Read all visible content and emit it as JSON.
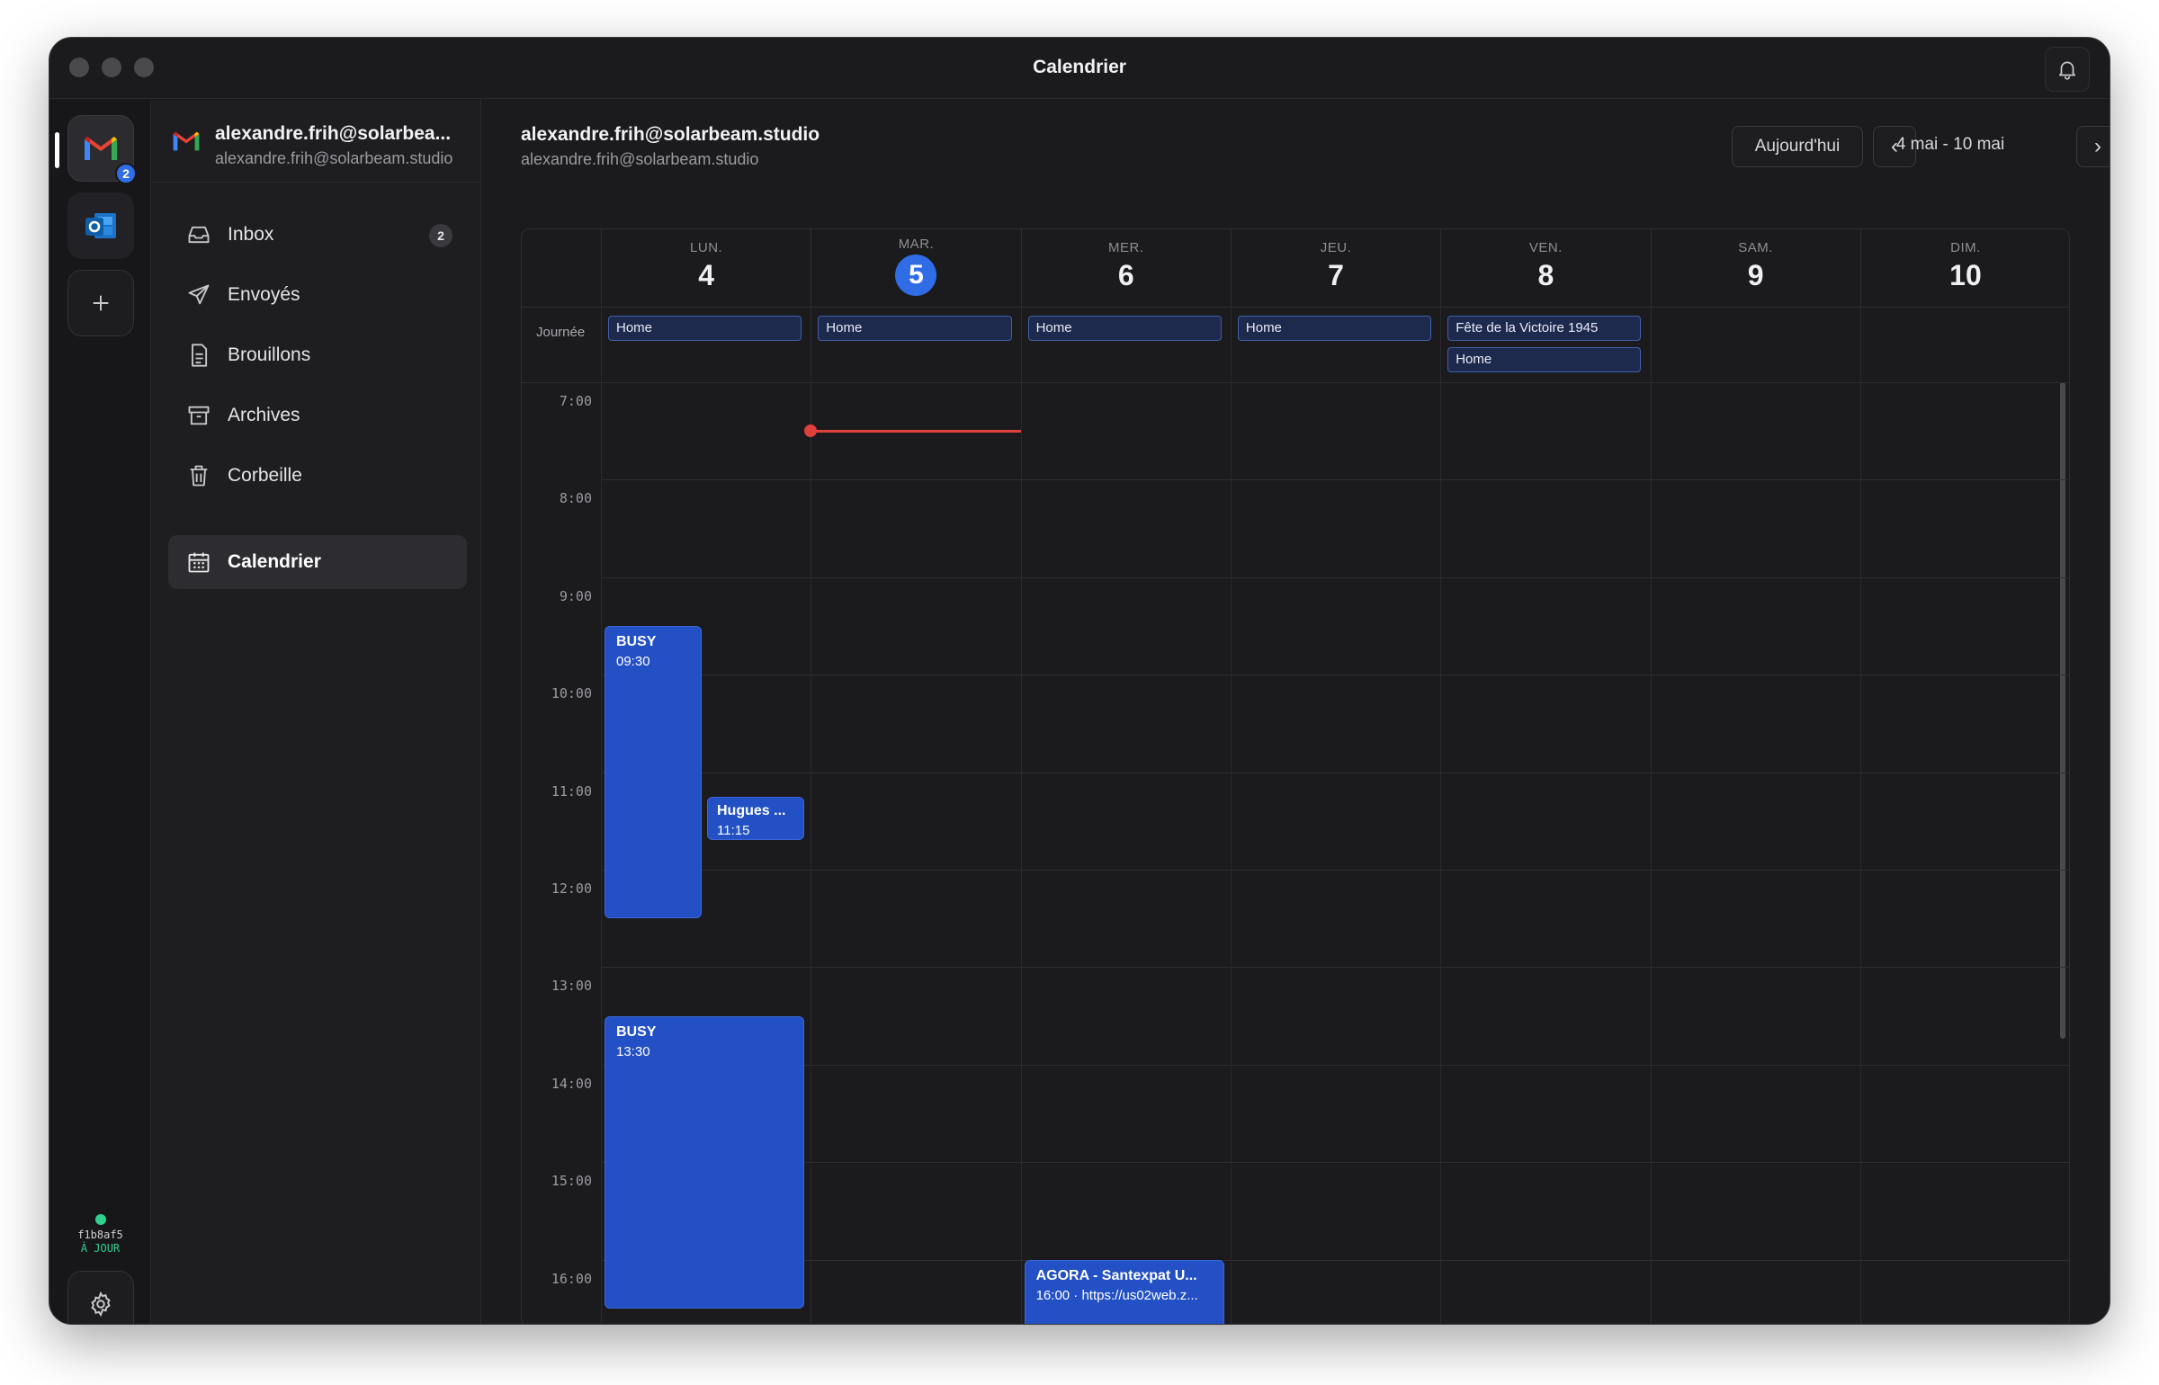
{
  "window": {
    "title": "Calendrier"
  },
  "rail": {
    "gmail_badge": "2",
    "sync_hash": "f1b8af5",
    "sync_status": "À JOUR"
  },
  "account": {
    "name": "alexandre.frih@solarbea...",
    "email": "alexandre.frih@solarbeam.studio"
  },
  "nav": [
    {
      "label": "Inbox",
      "count": "2",
      "icon": "inbox-icon"
    },
    {
      "label": "Envoyés",
      "icon": "send-icon"
    },
    {
      "label": "Brouillons",
      "icon": "draft-icon"
    },
    {
      "label": "Archives",
      "icon": "archive-icon"
    },
    {
      "label": "Corbeille",
      "icon": "trash-icon"
    },
    {
      "label": "Calendrier",
      "icon": "calendar-icon",
      "active": true
    }
  ],
  "main": {
    "title": "alexandre.frih@solarbeam.studio",
    "subtitle": "alexandre.frih@solarbeam.studio",
    "today_button": "Aujourd'hui",
    "range": "4 mai - 10 mai",
    "prev": "‹",
    "next": "›"
  },
  "calendar": {
    "allday_label": "Journée",
    "days": [
      {
        "name": "LUN.",
        "num": "4"
      },
      {
        "name": "MAR.",
        "num": "5",
        "today": true
      },
      {
        "name": "MER.",
        "num": "6"
      },
      {
        "name": "JEU.",
        "num": "7"
      },
      {
        "name": "VEN.",
        "num": "8"
      },
      {
        "name": "SAM.",
        "num": "9"
      },
      {
        "name": "DIM.",
        "num": "10"
      }
    ],
    "allday_events": [
      {
        "day": 0,
        "row": 0,
        "title": "Home"
      },
      {
        "day": 1,
        "row": 0,
        "title": "Home"
      },
      {
        "day": 2,
        "row": 0,
        "title": "Home"
      },
      {
        "day": 3,
        "row": 0,
        "title": "Home"
      },
      {
        "day": 4,
        "row": 0,
        "title": "Fête de la Victoire 1945"
      },
      {
        "day": 4,
        "row": 1,
        "title": "Home"
      }
    ],
    "hours": [
      "7:00",
      "8:00",
      "9:00",
      "10:00",
      "11:00",
      "12:00",
      "13:00",
      "14:00",
      "15:00",
      "16:00"
    ],
    "events": [
      {
        "title": "BUSY",
        "time": "09:30"
      },
      {
        "title": "Hugues ...",
        "time": "11:15"
      },
      {
        "title": "BUSY",
        "time": "13:30"
      },
      {
        "title": "AGORA - Santexpat U...",
        "time": "16:00 · https://us02web.z..."
      }
    ]
  }
}
